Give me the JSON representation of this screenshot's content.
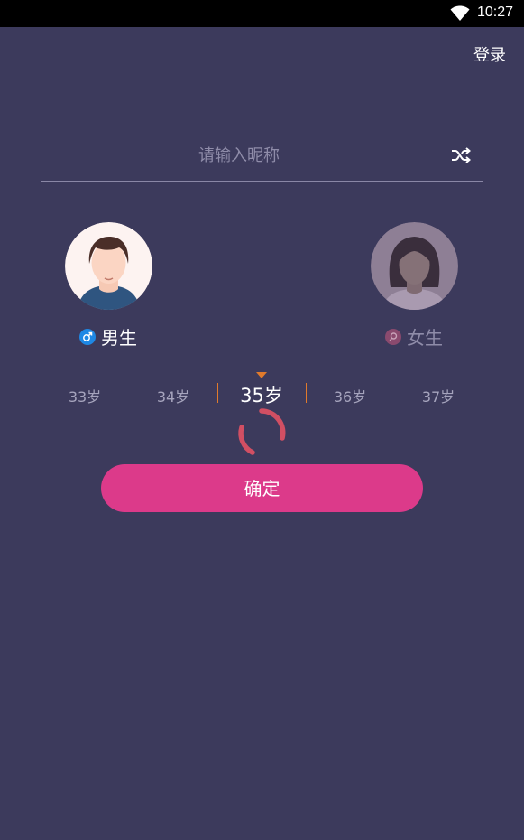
{
  "status_bar": {
    "time": "10:27",
    "wifi_icon": "wifi-icon"
  },
  "header": {
    "login_label": "登录"
  },
  "nickname": {
    "placeholder": "请输入昵称",
    "value": "",
    "shuffle_icon": "shuffle-icon"
  },
  "gender": {
    "male_label": "男生",
    "female_label": "女生",
    "selected": "male",
    "male_color": "#1e88e5",
    "female_color": "#c2406e"
  },
  "age_picker": {
    "items": [
      "33岁",
      "34岁",
      "35岁",
      "36岁",
      "37岁"
    ],
    "selected": "35岁",
    "accent_color": "#e07a2c"
  },
  "confirm": {
    "label": "确定",
    "color": "#dc3a8a"
  },
  "theme": {
    "background": "#3c3a5c"
  }
}
